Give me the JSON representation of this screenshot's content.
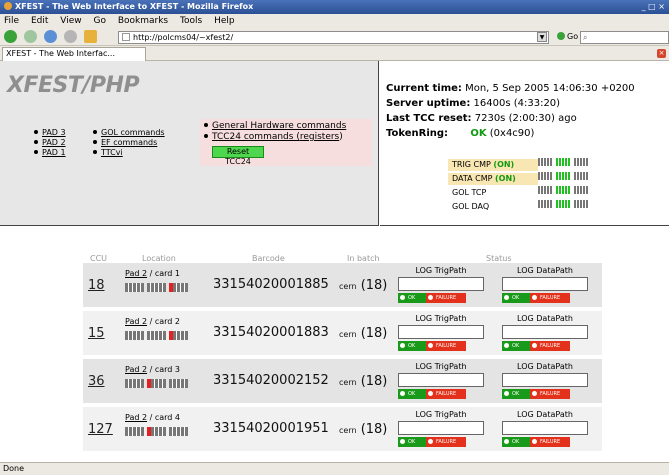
{
  "window": {
    "title": "XFEST - The Web Interface to XFEST - Mozilla Firefox",
    "controls": "_ □ ×"
  },
  "menu": [
    "File",
    "Edit",
    "View",
    "Go",
    "Bookmarks",
    "Tools",
    "Help"
  ],
  "nav": {
    "url": "http://polcms04/~xfest2/",
    "go_label": "Go"
  },
  "tab": {
    "title": "XFEST - The Web Interfac..."
  },
  "app": {
    "title": "XFEST/PHP",
    "pads": [
      "PAD 3",
      "PAD 2",
      "PAD 1"
    ],
    "commands": [
      "GOL commands",
      "EF commands",
      "TTCvi"
    ],
    "hw": {
      "general": "General Hardware commands",
      "tcc_prefix": "TCC24 commands (",
      "tcc_registers": "registers",
      "tcc_suffix": ")",
      "reset": "Reset TCC24"
    }
  },
  "status": {
    "current_time_label": "Current time:",
    "current_time": "Mon, 5 Sep 2005 14:06:30 +0200",
    "uptime_label": "Server uptime:",
    "uptime": "16400s (4:33:20)",
    "reset_label": "Last TCC reset:",
    "reset": "7230s (2:00:30) ago",
    "token_label": "TokenRing:",
    "token_ok": "OK",
    "token_code": "(0x4c90)",
    "lines": [
      {
        "label": "TRIG CMP",
        "state": "(ON)",
        "highlight": true,
        "bars": [
          "gray",
          "green",
          "gray"
        ]
      },
      {
        "label": "DATA CMP",
        "state": "(ON)",
        "highlight": true,
        "bars": [
          "gray",
          "green",
          "gray"
        ]
      },
      {
        "label": "GOL TCP",
        "state": "",
        "highlight": false,
        "bars": [
          "gray",
          "green",
          "gray"
        ]
      },
      {
        "label": "GOL DAQ",
        "state": "",
        "highlight": false,
        "bars": [
          "gray",
          "green",
          "gray"
        ]
      }
    ]
  },
  "table": {
    "headers": {
      "ccu": "CCU",
      "location": "Location",
      "barcode": "Barcode",
      "batch": "In batch",
      "status": "Status"
    },
    "log_trig": "LOG TrigPath",
    "log_data": "LOG DataPath",
    "ok_label": "OK",
    "fail_label": "FAILURE",
    "rows": [
      {
        "ccu": "18",
        "pad": "Pad 2",
        "card": " / card 1",
        "barcode": "33154020001885",
        "batch_prefix": "cern",
        "batch": "(18)",
        "red_block": 2
      },
      {
        "ccu": "15",
        "pad": "Pad 2",
        "card": " / card 2",
        "barcode": "33154020001883",
        "batch_prefix": "cern",
        "batch": "(18)",
        "red_block": 2
      },
      {
        "ccu": "36",
        "pad": "Pad 2",
        "card": " / card 3",
        "barcode": "33154020002152",
        "batch_prefix": "cern",
        "batch": "(18)",
        "red_block": 1
      },
      {
        "ccu": "127",
        "pad": "Pad 2",
        "card": " / card 4",
        "barcode": "33154020001951",
        "batch_prefix": "cern",
        "batch": "(18)",
        "red_block": 1
      }
    ]
  },
  "statusbar": "Done",
  "colors": {
    "ok_green": "#119a11",
    "fail_red": "#e3311b",
    "panel_gray": "#e7e7e7",
    "hw_pink": "#f7dede"
  }
}
